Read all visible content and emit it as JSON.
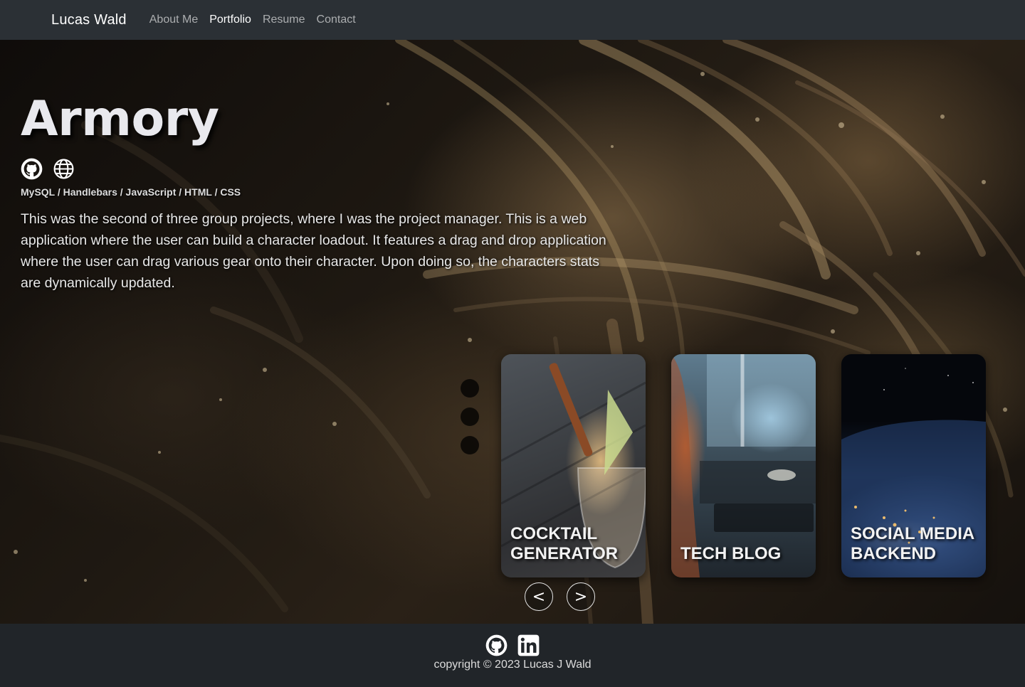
{
  "navbar": {
    "brand": "Lucas Wald",
    "links": [
      {
        "label": "About Me"
      },
      {
        "label": "Portfolio",
        "active": true
      },
      {
        "label": "Resume"
      },
      {
        "label": "Contact"
      }
    ]
  },
  "project": {
    "title": "Armory",
    "links": [
      {
        "icon": "github-icon"
      },
      {
        "icon": "globe-icon"
      }
    ],
    "tech_stack": "MySQL / Handlebars / JavaScript / HTML / CSS",
    "description": "This was the second of three group projects, where I was the project manager. This is a web application where the user can build a character loadout. It features a drag and drop application where the user can drag various gear onto their character. Upon doing so, the characters stats are dynamically updated."
  },
  "carousel": {
    "cards": [
      {
        "label": "Cocktail Generator"
      },
      {
        "label": "Tech Blog"
      },
      {
        "label": "Social Media Backend"
      }
    ],
    "prev_label": "<",
    "next_label": ">"
  },
  "footer": {
    "icons": [
      {
        "icon": "github-icon"
      },
      {
        "icon": "linkedin-icon"
      }
    ],
    "copyright": "copyright © 2023 Lucas J Wald"
  },
  "colors": {
    "navbar_bg": "#2b3035",
    "footer_bg": "#212529",
    "text_primary": "#ffffff"
  }
}
